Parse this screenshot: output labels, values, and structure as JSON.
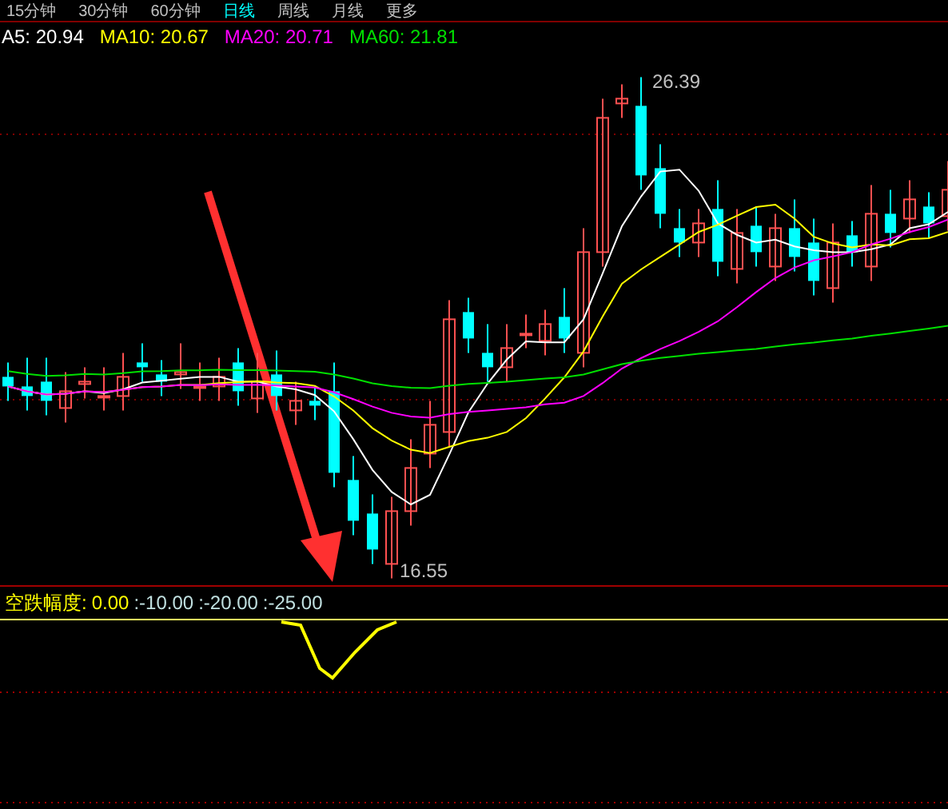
{
  "period_tabs": [
    {
      "label": "15分钟",
      "selected": false
    },
    {
      "label": "30分钟",
      "selected": false
    },
    {
      "label": "60分钟",
      "selected": false
    },
    {
      "label": "日线",
      "selected": true
    },
    {
      "label": "周线",
      "selected": false
    },
    {
      "label": "月线",
      "selected": false
    },
    {
      "label": "更多",
      "selected": false
    }
  ],
  "ma_legend": [
    {
      "label": "A5: 20.94",
      "color": "#ffffff"
    },
    {
      "label": "MA10: 20.67",
      "color": "#ffff00"
    },
    {
      "label": "MA20: 20.71",
      "color": "#ff00ff"
    },
    {
      "label": "MA60: 21.81",
      "color": "#00e000"
    }
  ],
  "price_labels": {
    "high": "26.39",
    "low": "16.55"
  },
  "indicator": {
    "name": "空跌幅度:",
    "values": [
      {
        "text": "0.00",
        "color": "#ffff00"
      },
      {
        "text": ":-10.00",
        "color": "#c0e0e0"
      },
      {
        "text": ":-20.00",
        "color": "#c0e0e0"
      },
      {
        "text": ":-25.00",
        "color": "#c0e0e0"
      }
    ]
  }
}
